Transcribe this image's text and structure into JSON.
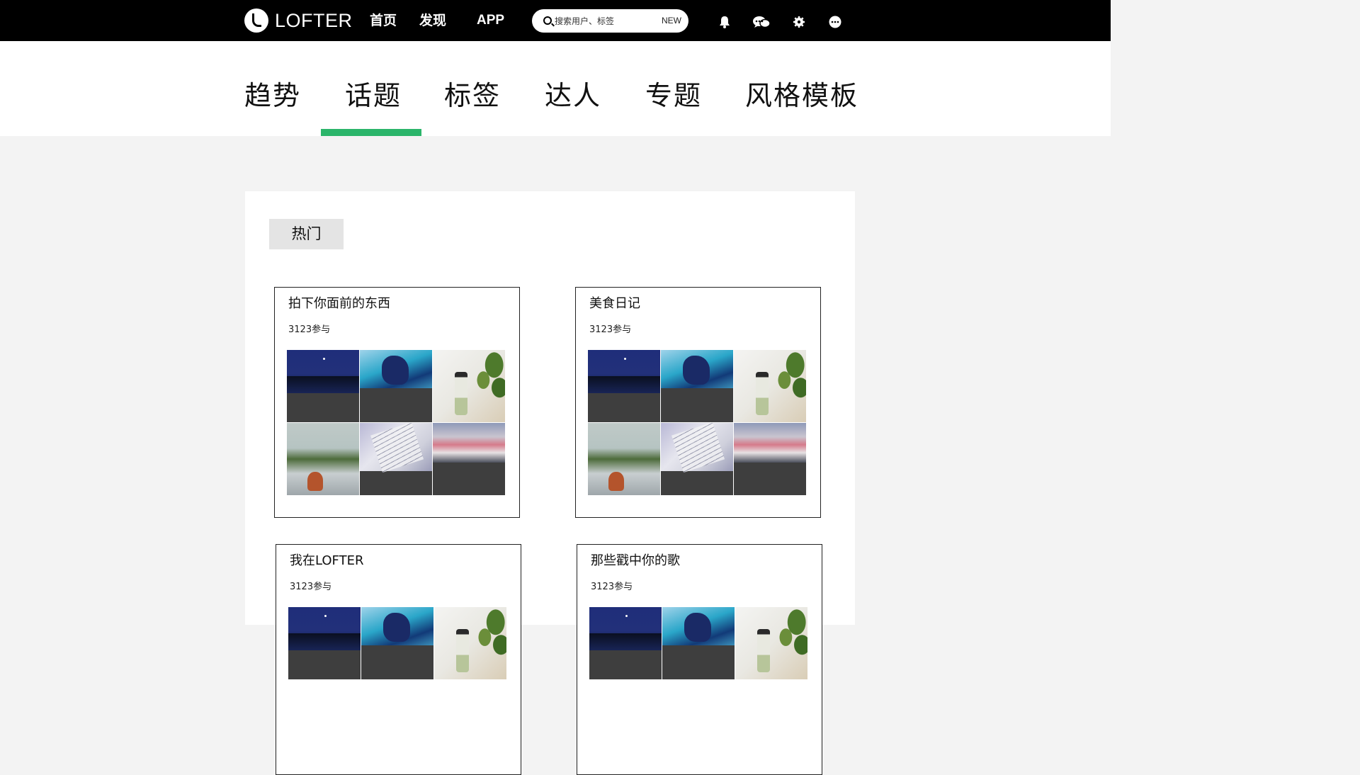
{
  "header": {
    "logo_text": "LOFTER",
    "nav": [
      "首页",
      "发现",
      "APP"
    ],
    "search": {
      "placeholder": "搜索用户、标签",
      "badge": "NEW"
    },
    "icons": [
      "bell-icon",
      "chat-icon",
      "gear-icon",
      "more-icon"
    ]
  },
  "tabs": {
    "items": [
      "趋势",
      "话题",
      "标签",
      "达人",
      "专题",
      "风格模板"
    ],
    "active": "话题",
    "accent_color": "#2bb56a"
  },
  "main": {
    "section_label": "热门",
    "topics": [
      {
        "title": "拍下你面前的东西",
        "count": "3123参与"
      },
      {
        "title": "美食日记",
        "count": "3123参与"
      },
      {
        "title": "我在LOFTER",
        "count": "3123参与"
      },
      {
        "title": "那些戳中你的歌",
        "count": "3123参与"
      }
    ]
  }
}
